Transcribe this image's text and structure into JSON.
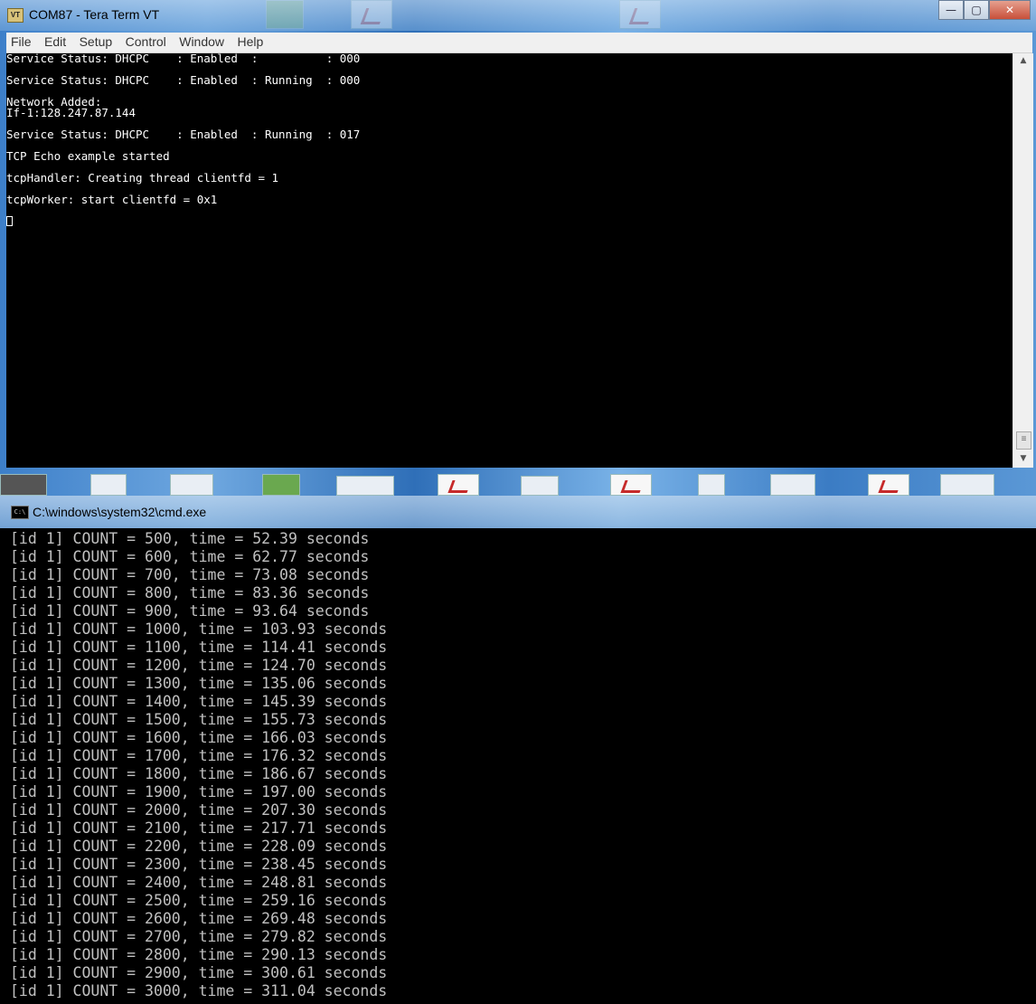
{
  "teraterm": {
    "title": "COM87 - Tera Term VT",
    "app_icon": "VT",
    "menu": [
      "File",
      "Edit",
      "Setup",
      "Control",
      "Window",
      "Help"
    ],
    "window_buttons": {
      "minimize": "—",
      "maximize": "▢",
      "close": "✕"
    },
    "lines": [
      "Service Status: DHCPC    : Enabled  :          : 000",
      "",
      "Service Status: DHCPC    : Enabled  : Running  : 000",
      "",
      "Network Added:",
      "If-1:128.247.87.144",
      "",
      "Service Status: DHCPC    : Enabled  : Running  : 017",
      "",
      "TCP Echo example started",
      "",
      "tcpHandler: Creating thread clientfd = 1",
      "",
      "tcpWorker: start clientfd = 0x1",
      ""
    ]
  },
  "cmd": {
    "title": "C:\\windows\\system32\\cmd.exe",
    "lines": [
      "[id 1] COUNT = 500, time = 52.39 seconds",
      "[id 1] COUNT = 600, time = 62.77 seconds",
      "[id 1] COUNT = 700, time = 73.08 seconds",
      "[id 1] COUNT = 800, time = 83.36 seconds",
      "[id 1] COUNT = 900, time = 93.64 seconds",
      "[id 1] COUNT = 1000, time = 103.93 seconds",
      "[id 1] COUNT = 1100, time = 114.41 seconds",
      "[id 1] COUNT = 1200, time = 124.70 seconds",
      "[id 1] COUNT = 1300, time = 135.06 seconds",
      "[id 1] COUNT = 1400, time = 145.39 seconds",
      "[id 1] COUNT = 1500, time = 155.73 seconds",
      "[id 1] COUNT = 1600, time = 166.03 seconds",
      "[id 1] COUNT = 1700, time = 176.32 seconds",
      "[id 1] COUNT = 1800, time = 186.67 seconds",
      "[id 1] COUNT = 1900, time = 197.00 seconds",
      "[id 1] COUNT = 2000, time = 207.30 seconds",
      "[id 1] COUNT = 2100, time = 217.71 seconds",
      "[id 1] COUNT = 2200, time = 228.09 seconds",
      "[id 1] COUNT = 2300, time = 238.45 seconds",
      "[id 1] COUNT = 2400, time = 248.81 seconds",
      "[id 1] COUNT = 2500, time = 259.16 seconds",
      "[id 1] COUNT = 2600, time = 269.48 seconds",
      "[id 1] COUNT = 2700, time = 279.82 seconds",
      "[id 1] COUNT = 2800, time = 290.13 seconds",
      "[id 1] COUNT = 2900, time = 300.61 seconds",
      "[id 1] COUNT = 3000, time = 311.04 seconds"
    ]
  }
}
